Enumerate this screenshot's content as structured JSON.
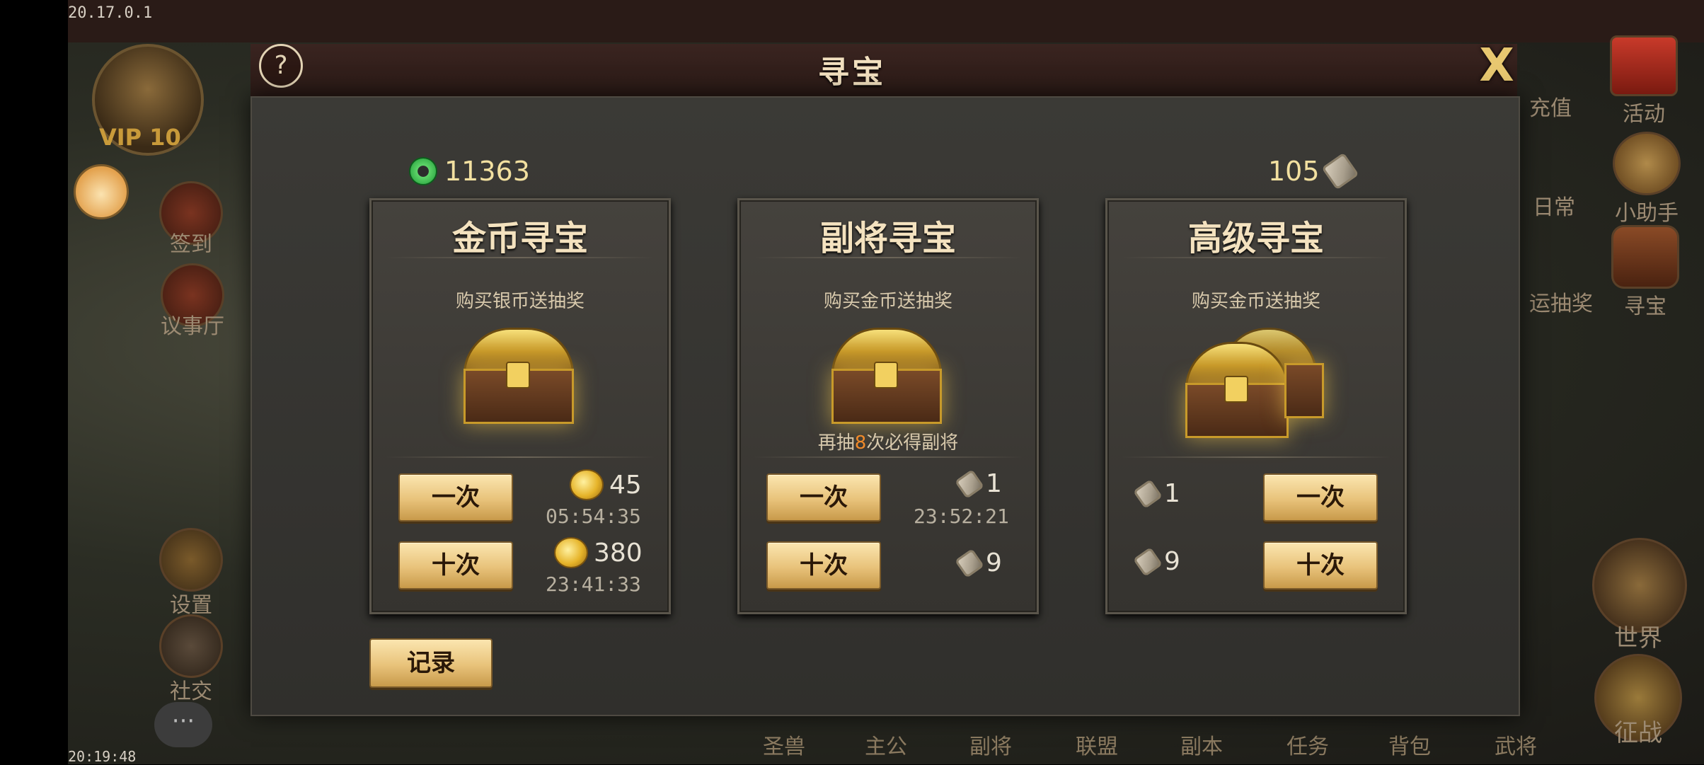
{
  "status": {
    "version": "20.17.0.1",
    "clock": "20:19:48"
  },
  "background": {
    "vip": "VIP 10",
    "left_menu": [
      "签到",
      "议事厅",
      "设置",
      "社交"
    ],
    "right_menu_top": [
      "充值",
      "活动"
    ],
    "right_menu_mid": [
      "日常",
      "小助手"
    ],
    "right_menu_row3": [
      "运抽奖",
      "寻宝"
    ],
    "right_big": [
      "世界",
      "征战"
    ],
    "bottom_nav": [
      "圣兽",
      "主公",
      "副将",
      "联盟",
      "副本",
      "任务",
      "背包",
      "武将"
    ]
  },
  "modal": {
    "title": "寻宝",
    "help": "?",
    "close": "X",
    "jade_amount": "11363",
    "scroll_amount": "105",
    "record": "记录",
    "cards": [
      {
        "title": "金币寻宝",
        "subtitle": "购买银币送抽奖",
        "once": "一次",
        "ten": "十次",
        "once_cost": "45",
        "once_timer": "05:54:35",
        "ten_cost": "380",
        "ten_timer": "23:41:33"
      },
      {
        "title": "副将寻宝",
        "subtitle": "购买金币送抽奖",
        "pity_prefix": "再抽",
        "pity_count": "8",
        "pity_suffix": "次必得副将",
        "once": "一次",
        "ten": "十次",
        "once_cost": "1",
        "once_timer": "23:52:21",
        "ten_cost": "9"
      },
      {
        "title": "高级寻宝",
        "subtitle": "购买金币送抽奖",
        "once": "一次",
        "ten": "十次",
        "once_cost": "1",
        "ten_cost": "9"
      }
    ]
  }
}
